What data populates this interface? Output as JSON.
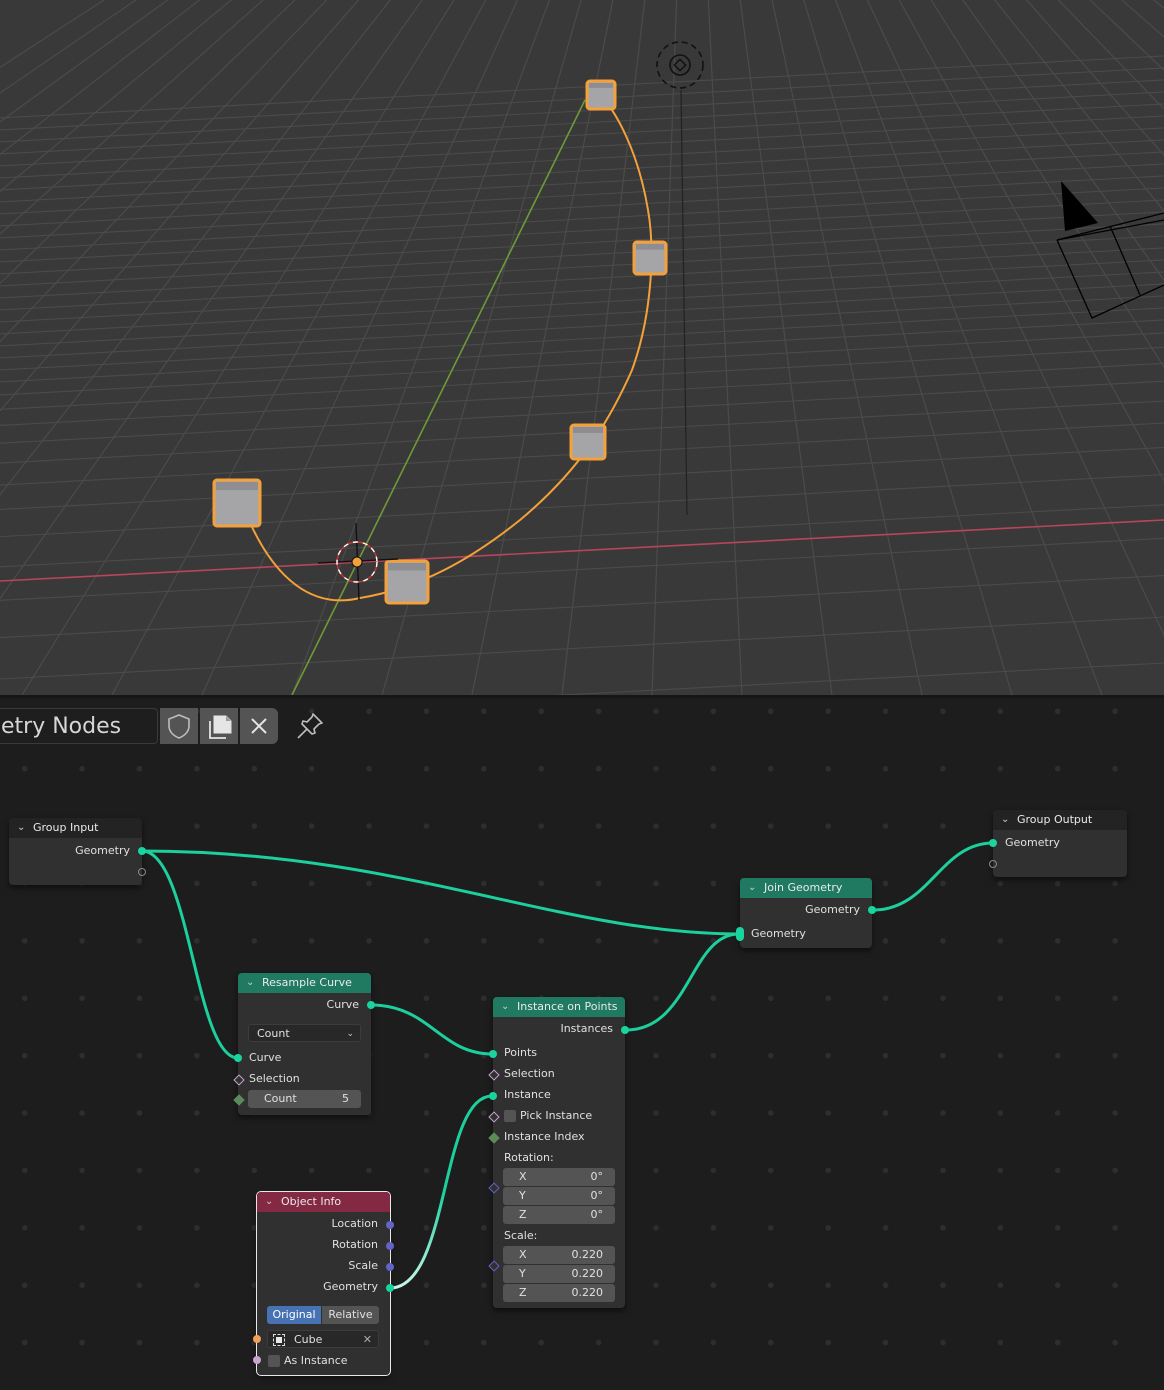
{
  "viewport": {
    "colors": {
      "background": "#393939",
      "grid": "#4b4b4b",
      "x_axis": "#b8455a",
      "y_axis": "#6f9a36",
      "curve": "#f4a13a",
      "selection_outline": "#f4a13a",
      "cube_fill": "#a5a5a8"
    },
    "objects": [
      "bezier-curve",
      "cube-instance",
      "cube-instance",
      "cube-instance",
      "cube-instance",
      "cube-instance",
      "3d-cursor",
      "light",
      "camera"
    ],
    "instance_count": 5
  },
  "editor": {
    "datablock_name": "etry Nodes",
    "buttons": {
      "fake_user": "shield-icon",
      "duplicate": "duplicate-icon",
      "unlink": "close-icon",
      "pin": "pin-icon"
    },
    "colors": {
      "geometry_socket": "#19d49e",
      "vector_socket": "#6363c7",
      "object_socket": "#ef9f56",
      "boolean_socket": "#c9a3cf",
      "integer_socket": "#5d8a5b",
      "geometry_header": "#1f7a61",
      "input_header": "#832944",
      "group_header": "#232323",
      "link": "#1ccf9d"
    },
    "nodes": {
      "group_input": {
        "title": "Group Input",
        "outputs": [
          "Geometry"
        ]
      },
      "group_output": {
        "title": "Group Output",
        "inputs": [
          "Geometry"
        ]
      },
      "join_geometry": {
        "title": "Join Geometry",
        "outputs": [
          "Geometry"
        ],
        "inputs": [
          "Geometry"
        ]
      },
      "resample_curve": {
        "title": "Resample Curve",
        "outputs": [
          "Curve"
        ],
        "mode": "Count",
        "inputs": [
          "Curve",
          "Selection"
        ],
        "count_label": "Count",
        "count_value": "5"
      },
      "instance_on_points": {
        "title": "Instance on Points",
        "outputs": [
          "Instances"
        ],
        "inputs": [
          "Points",
          "Selection",
          "Instance"
        ],
        "pick_instance": "Pick Instance",
        "instance_index": "Instance Index",
        "rotation_label": "Rotation:",
        "rotation": [
          {
            "axis": "X",
            "value": "0°"
          },
          {
            "axis": "Y",
            "value": "0°"
          },
          {
            "axis": "Z",
            "value": "0°"
          }
        ],
        "scale_label": "Scale:",
        "scale": [
          {
            "axis": "X",
            "value": "0.220"
          },
          {
            "axis": "Y",
            "value": "0.220"
          },
          {
            "axis": "Z",
            "value": "0.220"
          }
        ]
      },
      "object_info": {
        "title": "Object Info",
        "outputs": [
          "Location",
          "Rotation",
          "Scale",
          "Geometry"
        ],
        "transform_space": [
          "Original",
          "Relative"
        ],
        "transform_space_selected": "Original",
        "object": "Cube",
        "as_instance": "As Instance"
      }
    }
  }
}
